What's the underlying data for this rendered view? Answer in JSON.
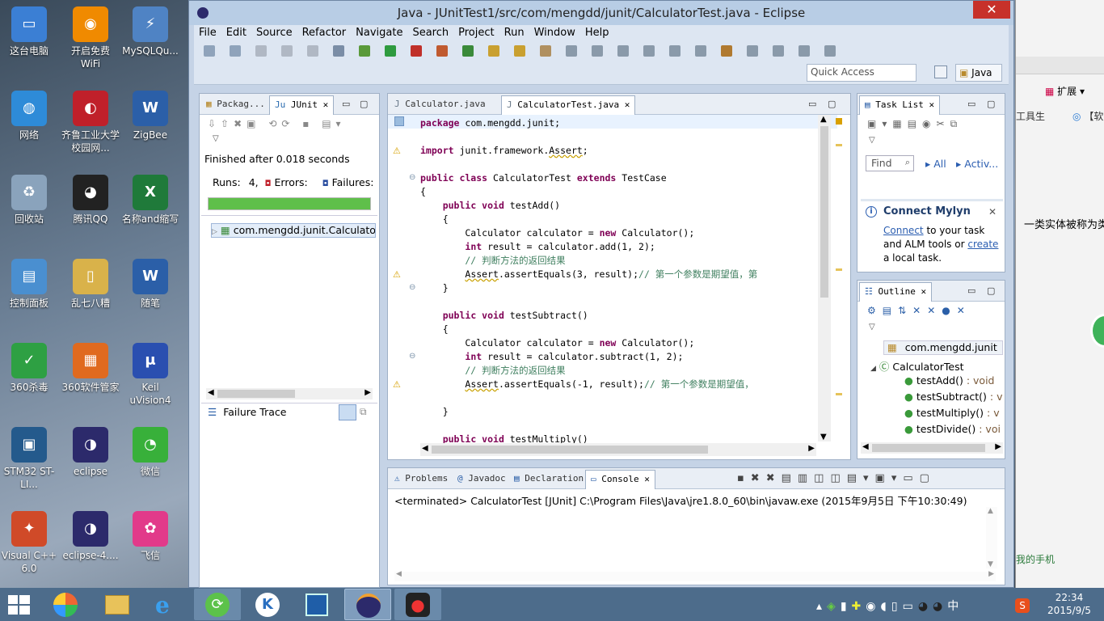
{
  "desktop": {
    "icons": [
      {
        "label": "这台电脑",
        "glyph": "▭",
        "color": "#3b7fd4"
      },
      {
        "label": "开启免费WiFi",
        "glyph": "◉",
        "color": "#f08a00"
      },
      {
        "label": "MySQLQu...",
        "glyph": "⚡",
        "color": "#4f83c4"
      },
      {
        "label": "网络",
        "glyph": "◍",
        "color": "#2e8bd8"
      },
      {
        "label": "齐鲁工业大学校园网...",
        "glyph": "◐",
        "color": "#c0202a"
      },
      {
        "label": "ZigBee",
        "glyph": "W",
        "color": "#2b5fa8"
      },
      {
        "label": "回收站",
        "glyph": "♻",
        "color": "#8aa3bc"
      },
      {
        "label": "腾讯QQ",
        "glyph": "◕",
        "color": "#222222"
      },
      {
        "label": "名称and缩写",
        "glyph": "X",
        "color": "#1f7a3a"
      },
      {
        "label": "控制面板",
        "glyph": "▤",
        "color": "#4a8fd0"
      },
      {
        "label": "乱七八糟",
        "glyph": "▯",
        "color": "#d9b24a"
      },
      {
        "label": "随笔",
        "glyph": "W",
        "color": "#2b5fa8"
      },
      {
        "label": "360杀毒",
        "glyph": "✓",
        "color": "#2ea043"
      },
      {
        "label": "360软件管家",
        "glyph": "▦",
        "color": "#e06a1f"
      },
      {
        "label": "Keil uVision4",
        "glyph": "μ",
        "color": "#2a4fb0"
      },
      {
        "label": "STM32 ST-LI...",
        "glyph": "▣",
        "color": "#245a8c"
      },
      {
        "label": "eclipse",
        "glyph": "◑",
        "color": "#2c2a6b"
      },
      {
        "label": "微信",
        "glyph": "◔",
        "color": "#38b03a"
      },
      {
        "label": "Visual C++ 6.0",
        "glyph": "✦",
        "color": "#d04a28"
      },
      {
        "label": "eclipse-4....",
        "glyph": "◑",
        "color": "#2c2a6b"
      },
      {
        "label": "飞信",
        "glyph": "✿",
        "color": "#e23a8a"
      }
    ]
  },
  "window": {
    "title": "Java - JUnitTest1/src/com/mengdd/junit/CalculatorTest.java - Eclipse",
    "close": "✕",
    "menu": [
      "File",
      "Edit",
      "Source",
      "Refactor",
      "Navigate",
      "Search",
      "Project",
      "Run",
      "Window",
      "Help"
    ],
    "quick_access_placeholder": "Quick Access",
    "perspective": "Java"
  },
  "junit": {
    "tab_package": "Packag...",
    "tab_junit": "JUnit",
    "finished": "Finished after 0.018 seconds",
    "runs_label": "Runs:",
    "runs_value": "4,",
    "errors_label": "Errors:",
    "failures_label": "Failures:",
    "progress": 1.0,
    "progress_color": "#5fbf4a",
    "tree_item": "com.mengdd.junit.Calculator",
    "failure_trace": "Failure Trace"
  },
  "editor": {
    "tabs": [
      "Calculator.java",
      "CalculatorTest.java"
    ],
    "lines": [
      {
        "p": [
          [
            "kw",
            "package"
          ],
          [
            "n",
            " com.mengdd.junit;"
          ]
        ]
      },
      {
        "p": []
      },
      {
        "warn": true,
        "p": [
          [
            "kw",
            "import"
          ],
          [
            "n",
            " junit.framework."
          ],
          [
            "w",
            "Assert"
          ],
          [
            "n",
            ";"
          ]
        ]
      },
      {
        "p": []
      },
      {
        "p": [
          [
            "kw",
            "public class"
          ],
          [
            "n",
            " CalculatorTest "
          ],
          [
            "kw",
            "extends"
          ],
          [
            "n",
            " TestCase"
          ]
        ]
      },
      {
        "p": [
          [
            "n",
            "{"
          ]
        ]
      },
      {
        "p": [
          [
            "n",
            "    "
          ],
          [
            "kw",
            "public void"
          ],
          [
            "n",
            " testAdd()"
          ]
        ]
      },
      {
        "p": [
          [
            "n",
            "    {"
          ]
        ]
      },
      {
        "p": [
          [
            "n",
            "        Calculator calculator = "
          ],
          [
            "kw",
            "new"
          ],
          [
            "n",
            " Calculator();"
          ]
        ]
      },
      {
        "p": [
          [
            "n",
            "        "
          ],
          [
            "kw",
            "int"
          ],
          [
            "n",
            " result = calculator.add(1, 2);"
          ]
        ]
      },
      {
        "p": [
          [
            "cm",
            "        // 判断方法的返回结果"
          ]
        ]
      },
      {
        "warn": true,
        "p": [
          [
            "n",
            "        "
          ],
          [
            "w",
            "Assert"
          ],
          [
            "n",
            ".assertEquals(3, result);"
          ],
          [
            "cm",
            "// 第一个参数是期望值，第"
          ]
        ]
      },
      {
        "p": [
          [
            "n",
            "    }"
          ]
        ]
      },
      {
        "p": []
      },
      {
        "p": [
          [
            "n",
            "    "
          ],
          [
            "kw",
            "public void"
          ],
          [
            "n",
            " testSubtract()"
          ]
        ]
      },
      {
        "p": [
          [
            "n",
            "    {"
          ]
        ]
      },
      {
        "p": [
          [
            "n",
            "        Calculator calculator = "
          ],
          [
            "kw",
            "new"
          ],
          [
            "n",
            " Calculator();"
          ]
        ]
      },
      {
        "p": [
          [
            "n",
            "        "
          ],
          [
            "kw",
            "int"
          ],
          [
            "n",
            " result = calculator.subtract(1, 2);"
          ]
        ]
      },
      {
        "p": [
          [
            "cm",
            "        // 判断方法的返回结果"
          ]
        ]
      },
      {
        "warn": true,
        "p": [
          [
            "n",
            "        "
          ],
          [
            "w",
            "Assert"
          ],
          [
            "n",
            ".assertEquals(-1, result);"
          ],
          [
            "cm",
            "// 第一个参数是期望值，"
          ]
        ]
      },
      {
        "p": []
      },
      {
        "p": [
          [
            "n",
            "    }"
          ]
        ]
      },
      {
        "p": []
      },
      {
        "p": [
          [
            "n",
            "    "
          ],
          [
            "kw",
            "public void"
          ],
          [
            "n",
            " testMultiply()"
          ]
        ]
      }
    ]
  },
  "tasklist": {
    "tab": "Task List",
    "find_placeholder": "Find",
    "all": "All",
    "activate": "Activ...",
    "mylyn_title": "Connect Mylyn",
    "mylyn_connect": "Connect",
    "mylyn_text1": " to your task and ALM tools or ",
    "mylyn_create": "create",
    "mylyn_text2": " a local task."
  },
  "outline": {
    "tab": "Outline",
    "package": "com.mengdd.junit",
    "class": "CalculatorTest",
    "methods": [
      {
        "name": "testAdd()",
        "ret": " : void"
      },
      {
        "name": "testSubtract()",
        "ret": " : v"
      },
      {
        "name": "testMultiply()",
        "ret": " : v"
      },
      {
        "name": "testDivide()",
        "ret": " : voi"
      }
    ]
  },
  "console": {
    "tabs": [
      "Problems",
      "Javadoc",
      "Declaration",
      "Console"
    ],
    "text": "<terminated> CalculatorTest [JUnit] C:\\Program Files\\Java\\jre1.8.0_60\\bin\\javaw.exe (2015年9月5日 下午10:30:49)"
  },
  "rightwin": {
    "item1": "扩展",
    "item2": "工具生",
    "item3": "【软",
    "text1": "一类实体被称为类",
    "text2": "我的手机"
  },
  "taskbar": {
    "time": "22:34",
    "date": "2015/9/5",
    "ime": "中"
  }
}
